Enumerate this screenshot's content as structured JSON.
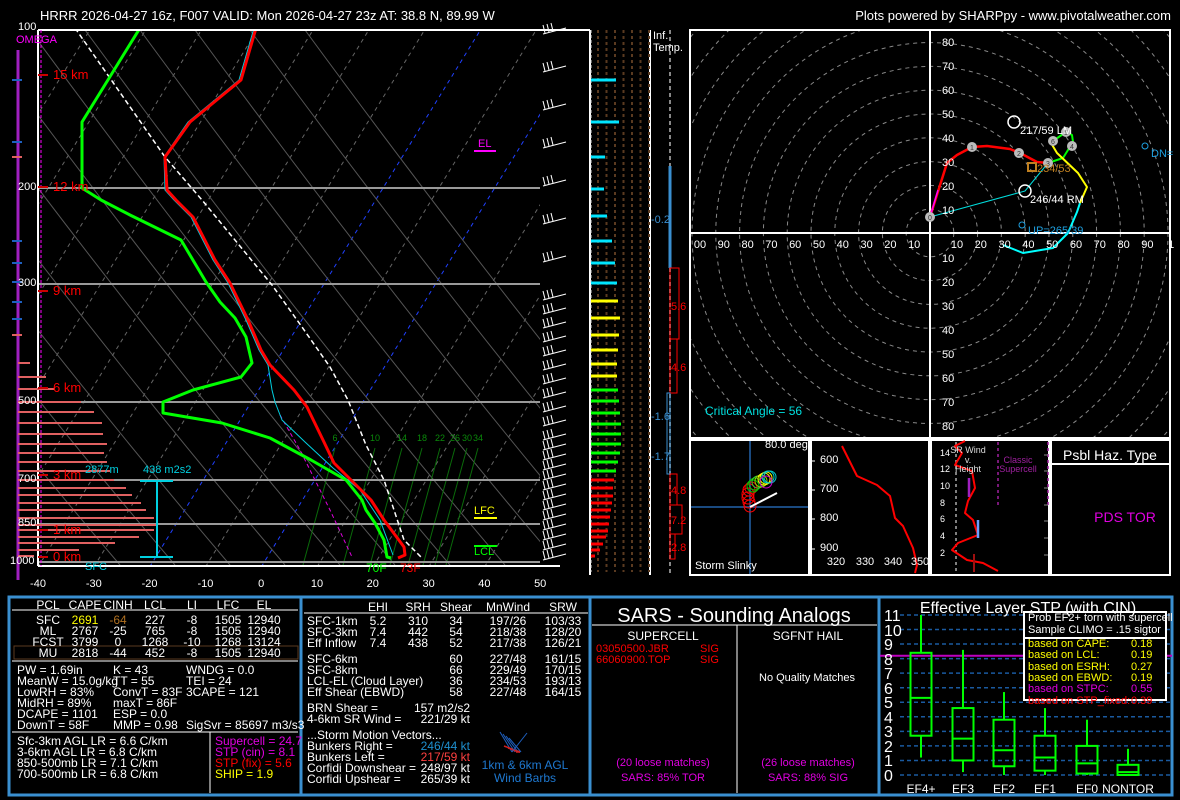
{
  "header": {
    "title": "HRRR 2026-04-27 16z, F007  VALID: Mon 2026-04-27 23z  AT: 38.8 N, 89.99 W",
    "credit": "Plots powered by SHARPpy - www.pivotalweather.com"
  },
  "skewt": {
    "omega_label": "OMEGA",
    "pressure_labels": [
      "100",
      "200",
      "300",
      "500",
      "700",
      "850",
      "1000"
    ],
    "height_labels": [
      "15 km",
      "12 km",
      "9 km",
      "6 km",
      "3 km",
      "1 km",
      "0 km"
    ],
    "temp_ticks": [
      "-40",
      "-30",
      "-20",
      "-10",
      "0",
      "10",
      "20",
      "30",
      "40",
      "50"
    ],
    "mixing_ratio_labels": [
      "6",
      "10",
      "14",
      "18",
      "22",
      "26",
      "30",
      "34"
    ],
    "el_label": "EL",
    "lfc_label": "LFC",
    "lcl_label": "LCL",
    "eff_inflow_top": "2877m",
    "eff_srh": "438 m2s2",
    "sfc_label": "SFC",
    "sfc_dewpoint": "70F",
    "sfc_temp": "73F",
    "colors": {
      "temperature": "#ff0000",
      "dewpoint": "#00ff00",
      "parcel": "#ffffff",
      "wetbulb": "#00d0e0"
    }
  },
  "inferred_temp": {
    "label_line1": "Inf.",
    "label_line2": "Temp.",
    "values": [
      "-0.2",
      "5.6",
      "4.6",
      "-1.6",
      "-1.7",
      "4.8",
      "7.2",
      "2.8"
    ]
  },
  "hodograph": {
    "axis_labels_up": [
      "80",
      "70",
      "60",
      "50",
      "40",
      "30",
      "20",
      "10"
    ],
    "axis_labels_down": [
      "10",
      "20",
      "30",
      "40",
      "50",
      "60",
      "70",
      "80"
    ],
    "axis_labels_left": [
      "00",
      "90",
      "80",
      "70",
      "60",
      "50",
      "40",
      "30",
      "20",
      "10"
    ],
    "axis_labels_right": [
      "10",
      "20",
      "30",
      "40",
      "50",
      "60",
      "70",
      "80",
      "90",
      "1"
    ],
    "height_markers": [
      "0",
      "1",
      "2",
      "3",
      "4",
      "5",
      "6"
    ],
    "left_mover": "217/59 LM",
    "right_mover": "246/44 RM",
    "mean_wind": "234/53",
    "upshear": "UP=265/39",
    "downshear": "DN=",
    "critical_angle": "Critical Angle = 56"
  },
  "slinky": {
    "angle": "80.0 deg",
    "label": "Storm Slinky"
  },
  "theta_e": {
    "pressure_labels": [
      "600",
      "700",
      "800",
      "900"
    ],
    "theta_labels": [
      "320",
      "330",
      "340",
      "350"
    ]
  },
  "sr_wind": {
    "title_lines": [
      "SR Wind",
      "v.",
      "Height"
    ],
    "classic_lines": [
      "Classic",
      "Supercell"
    ],
    "height_ticks": [
      "14",
      "12",
      "10",
      "8",
      "6",
      "4",
      "2"
    ]
  },
  "hazard": {
    "title": "Psbl Haz. Type",
    "value": "PDS TOR",
    "value_color": "#e000e0"
  },
  "parcels": {
    "headers": [
      "PCL",
      "CAPE",
      "CINH",
      "LCL",
      "LI",
      "LFC",
      "EL"
    ],
    "rows": [
      [
        "SFC",
        "2691",
        "-64",
        "227",
        "-8",
        "1505",
        "12940"
      ],
      [
        "ML",
        "2767",
        "-25",
        "765",
        "-8",
        "1505",
        "12940"
      ],
      [
        "FCST",
        "3799",
        "0",
        "1268",
        "-10",
        "1268",
        "13124"
      ],
      [
        "MU",
        "2818",
        "-44",
        "452",
        "-8",
        "1505",
        "12940"
      ]
    ]
  },
  "indices": {
    "col1": [
      "PW = 1.69in",
      "MeanW = 15.0g/kg",
      "LowRH = 83%",
      "MidRH = 89%",
      "DCAPE = 1101",
      "DownT = 58F"
    ],
    "col2": [
      "K = 43",
      "TT = 55",
      "ConvT = 83F",
      "maxT = 86F",
      "ESP = 0.0",
      "MMP = 0.98"
    ],
    "col3": [
      "WNDG = 0.0",
      "TEI = 24",
      "3CAPE = 121",
      "",
      "",
      "SigSvr = 85697 m3/s3"
    ]
  },
  "lapse_rates": [
    "Sfc-3km AGL LR = 6.6 C/km",
    "3-6km AGL LR = 6.8 C/km",
    "850-500mb LR = 7.1 C/km",
    "700-500mb LR = 6.8 C/km"
  ],
  "composites": [
    {
      "text": "Supercell = 24.7",
      "color": "#e000e0"
    },
    {
      "text": "STP (cin) = 8.1",
      "color": "#e000e0"
    },
    {
      "text": "STP (fix) = 5.6",
      "color": "#ff0000"
    },
    {
      "text": "SHIP = 1.9",
      "color": "#ffff00"
    }
  ],
  "kinematics": {
    "headers": [
      "EHI",
      "SRH",
      "Shear",
      "MnWind",
      "SRW"
    ],
    "rows": [
      [
        "SFC-1km",
        "5.2",
        "310",
        "34",
        "197/26",
        "103/33"
      ],
      [
        "SFC-3km",
        "7.4",
        "442",
        "54",
        "218/38",
        "128/20"
      ],
      [
        "Eff Inflow",
        "7.4",
        "438",
        "52",
        "217/38",
        "126/21"
      ],
      [
        "SFC-6km",
        "",
        "",
        "60",
        "227/48",
        "161/15"
      ],
      [
        "SFC-8km",
        "",
        "",
        "66",
        "229/49",
        "170/15"
      ],
      [
        "LCL-EL (Cloud Layer)",
        "",
        "",
        "36",
        "234/53",
        "193/13"
      ],
      [
        "Eff Shear (EBWD)",
        "",
        "",
        "58",
        "227/48",
        "164/15"
      ]
    ],
    "brn_label": "BRN Shear =",
    "brn_value": "157 m2/s2",
    "srwind_label": "4-6km SR Wind =",
    "srwind_value": "221/29 kt",
    "storm_motion_title": "...Storm Motion Vectors...",
    "storm_motion": [
      {
        "label": "Bunkers Right =",
        "value": "246/44 kt",
        "color": "#1e90d0"
      },
      {
        "label": "Bunkers Left =",
        "value": "217/59 kt",
        "color": "#ff4040"
      },
      {
        "label": "Corfidi Downshear =",
        "value": "248/97 kt",
        "color": "#ffffff"
      },
      {
        "label": "Corfidi Upshear =",
        "value": "265/39 kt",
        "color": "#ffffff"
      }
    ],
    "barb_legend_line1": "1km & 6km AGL",
    "barb_legend_line2": "Wind Barbs"
  },
  "sars": {
    "title": "SARS - Sounding Analogs",
    "supercell_title": "SUPERCELL",
    "hail_title": "SGFNT HAIL",
    "supercell_matches": [
      [
        "03050500.JBR",
        "SIG"
      ],
      [
        "66060900.TOP",
        "SIG"
      ]
    ],
    "hail_matches_text": "No Quality Matches",
    "supercell_loose": "(20 loose matches)",
    "supercell_result": "SARS: 85% TOR",
    "hail_loose": "(26 loose matches)",
    "hail_result": "SARS: 88% SIG"
  },
  "stp_panel": {
    "inset_header": [
      "Prob EF2+ torn with supercell",
      "Sample CLIMO = .15 sigtor"
    ],
    "inset_rows": [
      {
        "label": "based on CAPE:",
        "value": "0.18",
        "color": "#ffff00"
      },
      {
        "label": "based on LCL:",
        "value": "0.19",
        "color": "#ffff00"
      },
      {
        "label": "based on ESRH:",
        "value": "0.27",
        "color": "#ffff00"
      },
      {
        "label": "based on EBWD:",
        "value": "0.19",
        "color": "#ffff00"
      },
      {
        "label": "based on STPC:",
        "value": "0.55",
        "color": "#e000e0"
      },
      {
        "label": "based on STP_fixed:",
        "value": "0.39",
        "color": "#ff0000"
      }
    ]
  },
  "chart_data": {
    "type": "box",
    "title": "Effective Layer STP (with CIN)",
    "categories": [
      "EF4+",
      "EF3",
      "EF2",
      "EF1",
      "EF0",
      "NONTOR"
    ],
    "boxes": [
      {
        "min": 1.2,
        "q1": 2.7,
        "median": 5.3,
        "q3": 8.4,
        "max": 11
      },
      {
        "min": 0.2,
        "q1": 1.0,
        "median": 2.5,
        "q3": 4.6,
        "max": 8.6
      },
      {
        "min": 0,
        "q1": 0.6,
        "median": 1.7,
        "q3": 3.8,
        "max": 5.7
      },
      {
        "min": 0,
        "q1": 0.3,
        "median": 1.2,
        "q3": 2.7,
        "max": 4.6
      },
      {
        "min": 0,
        "q1": 0.1,
        "median": 0.8,
        "q3": 2.0,
        "max": 3.8
      },
      {
        "min": 0,
        "q1": 0,
        "median": 0.2,
        "q3": 0.7,
        "max": 1.8
      }
    ],
    "current_value": 8.2,
    "ylim": [
      0,
      11
    ],
    "yticks": [
      "0",
      "1",
      "2",
      "3",
      "4",
      "5",
      "6",
      "7",
      "8",
      "9",
      "10",
      "11"
    ],
    "grid": true,
    "box_color": "#00ff00",
    "current_color": "#c000c0"
  }
}
